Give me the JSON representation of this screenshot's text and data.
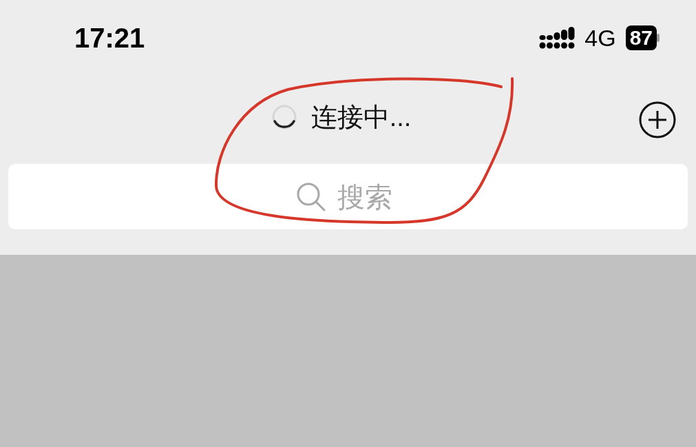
{
  "status_bar": {
    "time": "17:21",
    "network": "4G",
    "battery": "87"
  },
  "header": {
    "title": "连接中..."
  },
  "search": {
    "placeholder": "搜索"
  }
}
